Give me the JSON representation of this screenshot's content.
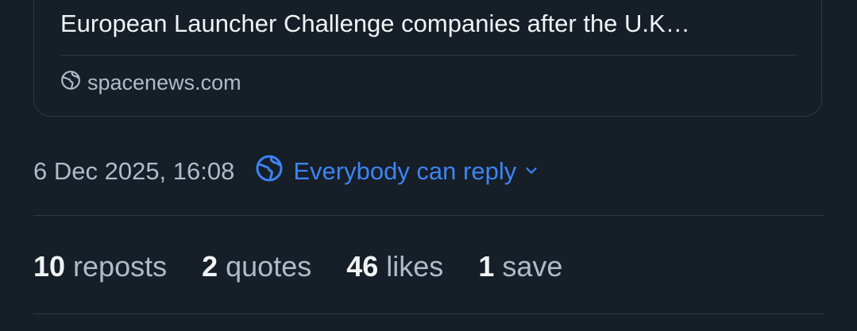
{
  "link_card": {
    "description": "European Launcher Challenge companies after the U.K…",
    "domain": "spacenews.com",
    "domain_icon": "globe-icon"
  },
  "post_meta": {
    "timestamp": "6 Dec 2025, 16:08",
    "reply_setting": "Everybody can reply",
    "reply_icon": "globe-icon",
    "accent_color": "#3d84f5"
  },
  "stats": [
    {
      "count": "10",
      "label": "reposts"
    },
    {
      "count": "2",
      "label": "quotes"
    },
    {
      "count": "46",
      "label": "likes"
    },
    {
      "count": "1",
      "label": "save"
    }
  ]
}
